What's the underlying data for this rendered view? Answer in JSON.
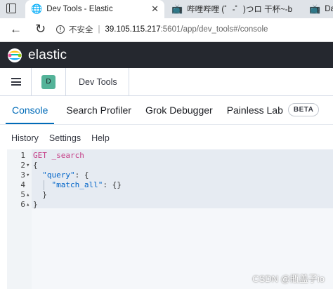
{
  "browser": {
    "tabs": [
      {
        "title": "Dev Tools - Elastic",
        "active": true
      },
      {
        "title": "哔哩哔哩 (゜-゜)つロ 干杯~-bilib",
        "active": false
      },
      {
        "title": "Da",
        "active": false
      }
    ],
    "close_glyph": "✕",
    "nav": {
      "back": "←",
      "reload": "↻"
    },
    "url": {
      "insecure_label": "不安全",
      "separator": "|",
      "host": "39.105.115.217",
      "path": ":5601/app/dev_tools#/console"
    }
  },
  "header": {
    "brand": "elastic",
    "space_initial": "D",
    "breadcrumb": "Dev Tools"
  },
  "tool_tabs": [
    {
      "label": "Console",
      "active": true
    },
    {
      "label": "Search Profiler",
      "active": false
    },
    {
      "label": "Grok Debugger",
      "active": false
    },
    {
      "label": "Painless Lab",
      "active": false
    }
  ],
  "beta_badge": "BETA",
  "menu": {
    "history": "History",
    "settings": "Settings",
    "help": "Help"
  },
  "editor": {
    "lines": [
      {
        "n": "1",
        "fold": "",
        "parts": [
          {
            "t": "GET",
            "c": "kw"
          },
          {
            "t": " _search",
            "c": "kw"
          }
        ]
      },
      {
        "n": "2",
        "fold": "▾",
        "parts": [
          {
            "t": "{",
            "c": "punc"
          }
        ]
      },
      {
        "n": "3",
        "fold": "▾",
        "parts": [
          {
            "t": "  ",
            "c": "punc"
          },
          {
            "t": "\"query\"",
            "c": "str"
          },
          {
            "t": ": {",
            "c": "punc"
          }
        ]
      },
      {
        "n": "4",
        "fold": "",
        "parts": [
          {
            "t": "    ",
            "c": "punc"
          },
          {
            "t": "\"match_all\"",
            "c": "str"
          },
          {
            "t": ": {}",
            "c": "punc"
          }
        ]
      },
      {
        "n": "5",
        "fold": "▴",
        "parts": [
          {
            "t": "  }",
            "c": "punc"
          }
        ]
      },
      {
        "n": "6",
        "fold": "▴",
        "parts": [
          {
            "t": "}",
            "c": "punc"
          }
        ]
      }
    ]
  },
  "watermark": "CSDN @瓶盖子io",
  "colors": {
    "accent": "#006bb8",
    "header_bg": "#25282f",
    "space_badge": "#54b399"
  }
}
